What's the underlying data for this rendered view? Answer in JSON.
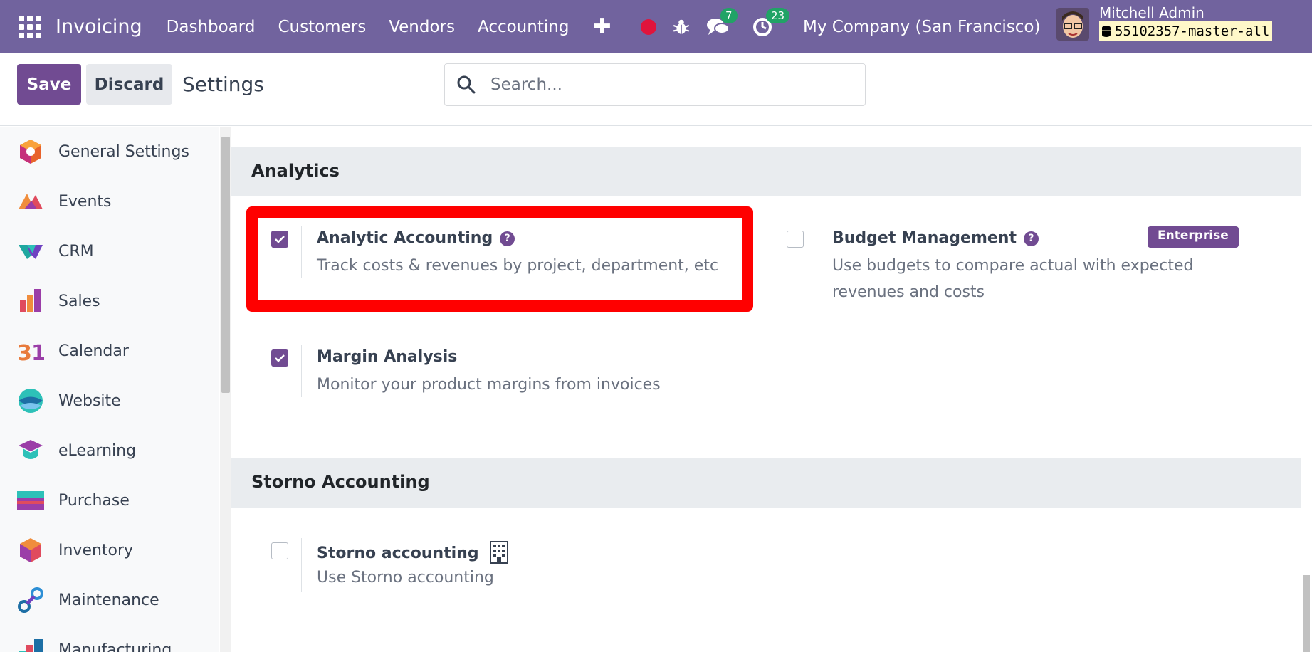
{
  "navbar": {
    "app_name": "Invoicing",
    "menu": [
      "Dashboard",
      "Customers",
      "Vendors",
      "Accounting"
    ],
    "plus": "✚",
    "messages_count": "7",
    "activities_count": "23",
    "company": "My Company (San Francisco)",
    "user_name": "Mitchell Admin",
    "db_name": "55102357-master-all"
  },
  "control": {
    "save_label": "Save",
    "discard_label": "Discard",
    "title": "Settings",
    "search_placeholder": "Search..."
  },
  "sidebar": {
    "items": [
      {
        "label": "General Settings",
        "icon": "general-settings-icon"
      },
      {
        "label": "Events",
        "icon": "events-icon"
      },
      {
        "label": "CRM",
        "icon": "crm-icon"
      },
      {
        "label": "Sales",
        "icon": "sales-icon"
      },
      {
        "label": "Calendar",
        "icon": "calendar-icon"
      },
      {
        "label": "Website",
        "icon": "website-icon"
      },
      {
        "label": "eLearning",
        "icon": "elearning-icon"
      },
      {
        "label": "Purchase",
        "icon": "purchase-icon"
      },
      {
        "label": "Inventory",
        "icon": "inventory-icon"
      },
      {
        "label": "Maintenance",
        "icon": "maintenance-icon"
      },
      {
        "label": "Manufacturing",
        "icon": "manufacturing-icon"
      }
    ]
  },
  "sections": {
    "analytics": {
      "title": "Analytics",
      "analytic_accounting": {
        "title": "Analytic Accounting",
        "desc": "Track costs & revenues by project, department, etc",
        "checked": true
      },
      "budget_management": {
        "title": "Budget Management",
        "desc": "Use budgets to compare actual with expected revenues and costs",
        "checked": false,
        "badge": "Enterprise"
      },
      "margin_analysis": {
        "title": "Margin Analysis",
        "desc": "Monitor your product margins from invoices",
        "checked": true
      }
    },
    "storno": {
      "title": "Storno Accounting",
      "storno_accounting": {
        "title": "Storno accounting",
        "desc": "Use Storno accounting",
        "checked": false
      }
    }
  },
  "colors": {
    "navbar": "#71639e",
    "primary": "#714b92",
    "highlight": "#ff0000",
    "badge": "#21a366"
  }
}
